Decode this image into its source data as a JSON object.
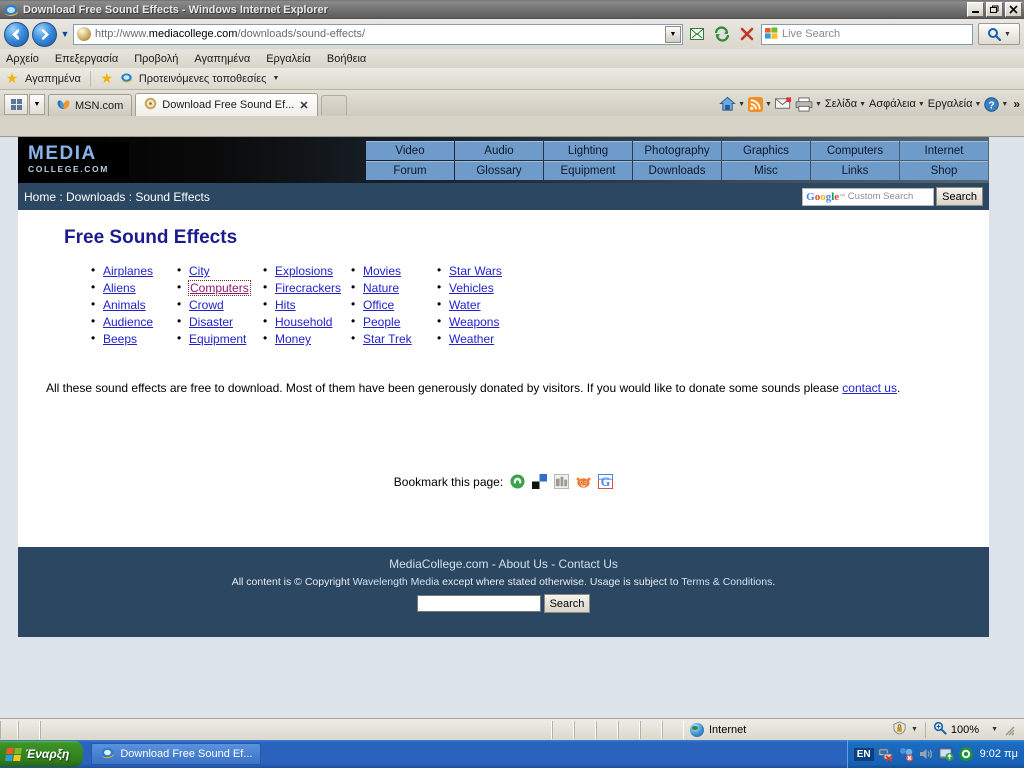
{
  "window": {
    "title": "Download Free Sound Effects - Windows Internet Explorer",
    "minimize": "_",
    "maximize": "❐",
    "close": "✕"
  },
  "browser": {
    "address": {
      "url_protocol": "http://www.",
      "url_domain": "mediacollege.com",
      "url_path": "/downloads/sound-effects/",
      "full_url": "http://www.mediacollege.com/downloads/sound-effects/"
    },
    "search": {
      "placeholder": "Live Search",
      "value": ""
    },
    "menu": [
      {
        "label": "Αρχείο"
      },
      {
        "label": "Επεξεργασία"
      },
      {
        "label": "Προβολή"
      },
      {
        "label": "Αγαπημένα"
      },
      {
        "label": "Εργαλεία"
      },
      {
        "label": "Βοήθεια"
      }
    ],
    "favorites_bar": {
      "favorites_label": "Αγαπημένα",
      "suggested_sites_label": "Προτεινόμενες τοποθεσίες"
    },
    "tabs": [
      {
        "label": "MSN.com",
        "active": false
      },
      {
        "label": "Download Free Sound Ef...",
        "active": true
      }
    ],
    "command_bar": [
      {
        "label": "Σελίδα"
      },
      {
        "label": "Ασφάλεια"
      },
      {
        "label": "Εργαλεία"
      }
    ],
    "command_bar_overflow": "»"
  },
  "site": {
    "logo": {
      "line1": "MEDIA",
      "line2": "COLLEGE.COM"
    },
    "nav": [
      "Video",
      "Audio",
      "Lighting",
      "Photography",
      "Graphics",
      "Computers",
      "Internet",
      "Forum",
      "Glossary",
      "Equipment",
      "Downloads",
      "Misc",
      "Links",
      "Shop"
    ],
    "breadcrumb": "Home : Downloads : Sound Effects",
    "google_search": {
      "logo_text": "Google",
      "tm": "™",
      "placeholder": "Custom Search",
      "button": "Search"
    },
    "page_title": "Free Sound Effects",
    "categories": [
      [
        "Airplanes",
        "Aliens",
        "Animals",
        "Audience",
        "Beeps"
      ],
      [
        "City",
        "Computers",
        "Crowd",
        "Disaster",
        "Equipment"
      ],
      [
        "Explosions",
        "Firecrackers",
        "Hits",
        "Household",
        "Money"
      ],
      [
        "Movies",
        "Nature",
        "Office",
        "People",
        "Star Trek"
      ],
      [
        "Star Wars",
        "Vehicles",
        "Water",
        "Weapons",
        "Weather"
      ]
    ],
    "focused_category": "Computers",
    "intro": {
      "text_before": "All these sound effects are free to download. Most of them have been generously donated by visitors. If you would like to donate some sounds please ",
      "link": "contact us",
      "text_after": "."
    },
    "bookmark": {
      "label": "Bookmark this page:",
      "icons": [
        "stumbleupon-icon",
        "delicious-icon",
        "digg-icon",
        "reddit-icon",
        "google-bookmark-icon"
      ]
    },
    "footer": {
      "line1_a": "MediaCollege.com",
      "line1_sep1": " - ",
      "line1_b": "About Us",
      "line1_sep2": " - ",
      "line1_c": "Contact Us",
      "line2_a": "All content is © Copyright ",
      "line2_link1": "Wavelength Media",
      "line2_b": " except where stated otherwise. Usage is subject to ",
      "line2_link2": "Terms & Conditions",
      "line2_c": ".",
      "search_value": "",
      "search_button": "Search"
    }
  },
  "statusbar": {
    "zone": "Internet",
    "zoom": "100%"
  },
  "taskbar": {
    "start": "Έναρξη",
    "tasks": [
      {
        "label": "Download Free Sound Ef..."
      }
    ],
    "tray": {
      "language": "EN",
      "clock": "9:02 πμ"
    }
  },
  "colors": {
    "site_dark_blue": "#2b4761",
    "nav_blue": "#6e9bc9",
    "link_blue": "#2222cc",
    "title_blue": "#1b1b8f"
  }
}
